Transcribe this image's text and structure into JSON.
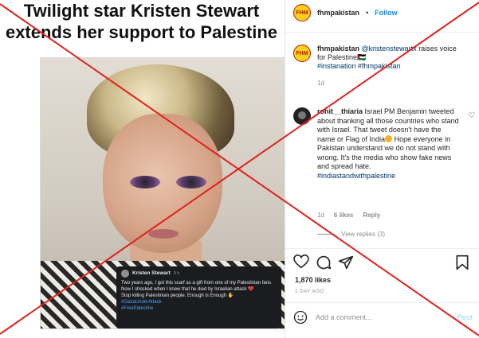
{
  "headline": {
    "line1": "Twilight star Kristen Stewart",
    "line2": "extends her support to Palestine"
  },
  "tweet": {
    "name": "Kristen Stewart",
    "time": "9 h",
    "text1": "Two years ago, I got this scarf as a gift from one of my Palestinian fans",
    "text2": "Now I shocked when I knew that he died by Israelian attack 💔",
    "text3": "Stop killing Palestinian people, Enough is Enough ✋",
    "tag1": "#GazaUnderAttack",
    "tag2": "#FreePalestine"
  },
  "header": {
    "logo": "FHM",
    "username": "fhmpakistan",
    "separator": "•",
    "follow": "Follow",
    "more": "..."
  },
  "caption": {
    "username": "fhmpakistan",
    "mention": "@kristenstewartx",
    "text": " raises voice for Palestine🇵🇸",
    "hashtags": "#instanation #fhmpakistan",
    "time": "1d"
  },
  "comment": {
    "username": "rohit__thiaria",
    "text_part1": " Israel PM Benjamin tweeted about thanking all those countries who stand with Israel. That tweet doesn't have the name or Flag of India",
    "text_part2": " Hope everyone in Pakistan understand we do not stand with wrong. It's the media who show fake news and spread hate.",
    "hashtag": "#indiastandwithpalestine",
    "time": "1d",
    "likes": "6 likes",
    "reply": "Reply",
    "view_replies": "View replies (3)"
  },
  "post": {
    "likes": "1,870 likes",
    "date": "1 DAY AGO"
  },
  "add_comment": {
    "placeholder": "Add a comment...",
    "post": "Post"
  },
  "icons": {
    "heart": "heart-icon",
    "comment": "comment-icon",
    "share": "share-icon",
    "save": "bookmark-icon",
    "emoji": "emoji-icon"
  },
  "colors": {
    "follow": "#0095f6",
    "cross": "#e0221e",
    "hashtag": "#00376b"
  }
}
